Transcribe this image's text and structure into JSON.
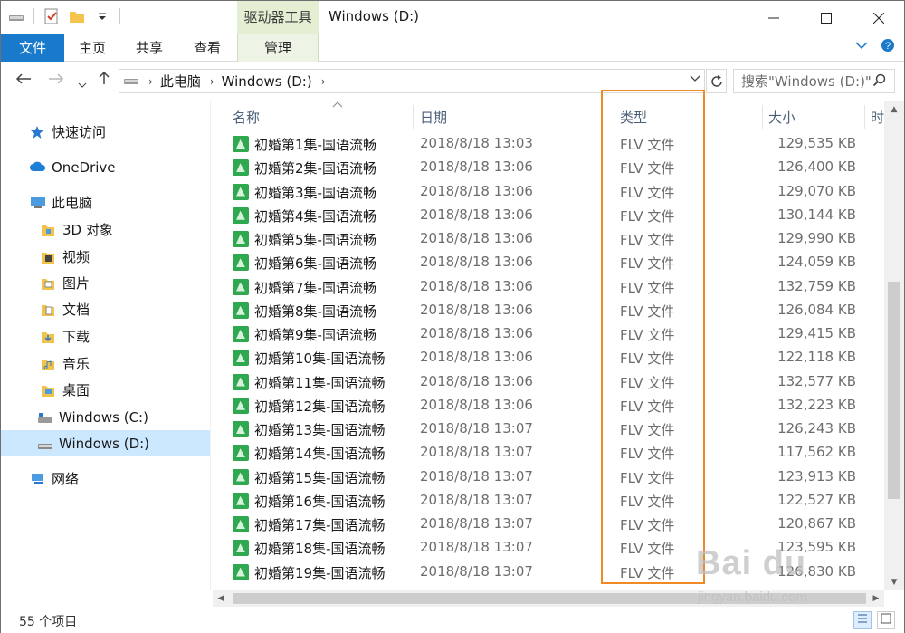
{
  "window": {
    "title": "Windows (D:)",
    "context_tab": "驱动器工具",
    "min_icon": "minimize-icon",
    "max_icon": "maximize-icon",
    "close_icon": "close-icon"
  },
  "ribbon": {
    "tabs": [
      {
        "label": "文件",
        "active": true
      },
      {
        "label": "主页"
      },
      {
        "label": "共享"
      },
      {
        "label": "查看"
      },
      {
        "label": "管理",
        "contextual": true
      }
    ],
    "accent": "#1979ca",
    "context_color": "#e3eed2"
  },
  "address": {
    "crumbs": [
      "此电脑",
      "Windows (D:)"
    ],
    "search_placeholder": "搜索\"Windows (D:)\""
  },
  "sidebar": {
    "items": [
      {
        "label": "快速访问",
        "icon": "star-icon"
      },
      {
        "label": "OneDrive",
        "icon": "cloud-icon"
      },
      {
        "label": "此电脑",
        "icon": "computer-icon"
      },
      {
        "label": "3D 对象",
        "icon": "folder-3d-icon"
      },
      {
        "label": "视频",
        "icon": "folder-video-icon"
      },
      {
        "label": "图片",
        "icon": "folder-pictures-icon"
      },
      {
        "label": "文档",
        "icon": "folder-documents-icon"
      },
      {
        "label": "下载",
        "icon": "folder-downloads-icon"
      },
      {
        "label": "音乐",
        "icon": "folder-music-icon"
      },
      {
        "label": "桌面",
        "icon": "folder-desktop-icon"
      },
      {
        "label": "Windows (C:)",
        "icon": "drive-c-icon"
      },
      {
        "label": "Windows (D:)",
        "icon": "drive-d-icon",
        "selected": true
      },
      {
        "label": "网络",
        "icon": "network-icon"
      }
    ]
  },
  "columns": {
    "name": "名称",
    "date": "日期",
    "type": "类型",
    "size": "大小",
    "time": "时"
  },
  "files": [
    {
      "name": "初婚第1集-国语流畅",
      "date": "2018/8/18 13:03",
      "type": "FLV 文件",
      "size": "129,535 KB"
    },
    {
      "name": "初婚第2集-国语流畅",
      "date": "2018/8/18 13:06",
      "type": "FLV 文件",
      "size": "126,400 KB"
    },
    {
      "name": "初婚第3集-国语流畅",
      "date": "2018/8/18 13:06",
      "type": "FLV 文件",
      "size": "129,070 KB"
    },
    {
      "name": "初婚第4集-国语流畅",
      "date": "2018/8/18 13:06",
      "type": "FLV 文件",
      "size": "130,144 KB"
    },
    {
      "name": "初婚第5集-国语流畅",
      "date": "2018/8/18 13:06",
      "type": "FLV 文件",
      "size": "129,990 KB"
    },
    {
      "name": "初婚第6集-国语流畅",
      "date": "2018/8/18 13:06",
      "type": "FLV 文件",
      "size": "124,059 KB"
    },
    {
      "name": "初婚第7集-国语流畅",
      "date": "2018/8/18 13:06",
      "type": "FLV 文件",
      "size": "132,759 KB"
    },
    {
      "name": "初婚第8集-国语流畅",
      "date": "2018/8/18 13:06",
      "type": "FLV 文件",
      "size": "126,084 KB"
    },
    {
      "name": "初婚第9集-国语流畅",
      "date": "2018/8/18 13:06",
      "type": "FLV 文件",
      "size": "129,415 KB"
    },
    {
      "name": "初婚第10集-国语流畅",
      "date": "2018/8/18 13:06",
      "type": "FLV 文件",
      "size": "122,118 KB"
    },
    {
      "name": "初婚第11集-国语流畅",
      "date": "2018/8/18 13:06",
      "type": "FLV 文件",
      "size": "132,577 KB"
    },
    {
      "name": "初婚第12集-国语流畅",
      "date": "2018/8/18 13:06",
      "type": "FLV 文件",
      "size": "132,223 KB"
    },
    {
      "name": "初婚第13集-国语流畅",
      "date": "2018/8/18 13:07",
      "type": "FLV 文件",
      "size": "126,243 KB"
    },
    {
      "name": "初婚第14集-国语流畅",
      "date": "2018/8/18 13:07",
      "type": "FLV 文件",
      "size": "117,562 KB"
    },
    {
      "name": "初婚第15集-国语流畅",
      "date": "2018/8/18 13:07",
      "type": "FLV 文件",
      "size": "123,913 KB"
    },
    {
      "name": "初婚第16集-国语流畅",
      "date": "2018/8/18 13:07",
      "type": "FLV 文件",
      "size": "122,527 KB"
    },
    {
      "name": "初婚第17集-国语流畅",
      "date": "2018/8/18 13:07",
      "type": "FLV 文件",
      "size": "120,867 KB"
    },
    {
      "name": "初婚第18集-国语流畅",
      "date": "2018/8/18 13:07",
      "type": "FLV 文件",
      "size": "123,595 KB"
    },
    {
      "name": "初婚第19集-国语流畅",
      "date": "2018/8/18 13:07",
      "type": "FLV 文件",
      "size": "126,830 KB"
    }
  ],
  "status": {
    "item_count": "55 个项目"
  },
  "watermark": {
    "brand": "Bai du",
    "url": "jingyan.baidu.com"
  },
  "colors": {
    "highlight": "#f08a24",
    "selection": "#cce8ff",
    "file_icon": "#2fa84f"
  }
}
